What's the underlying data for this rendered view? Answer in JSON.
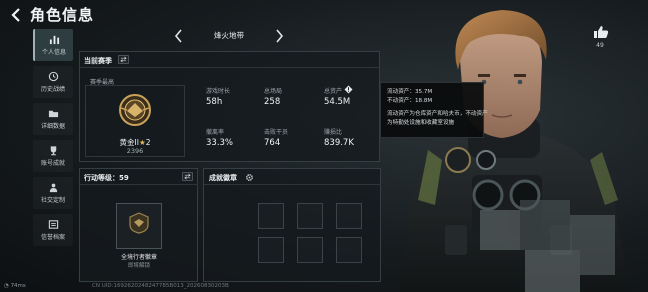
{
  "header": {
    "title": "角色信息"
  },
  "sidebar": {
    "items": [
      {
        "label": "个人信息",
        "icon": "bar-chart-icon",
        "active": true
      },
      {
        "label": "历史战绩",
        "icon": "history-icon",
        "active": false
      },
      {
        "label": "详细数据",
        "icon": "folder-icon",
        "active": false
      },
      {
        "label": "账号成就",
        "icon": "trophy-icon",
        "active": false
      },
      {
        "label": "社交定制",
        "icon": "social-icon",
        "active": false
      },
      {
        "label": "信誉档案",
        "icon": "credit-icon",
        "active": false
      }
    ]
  },
  "season": {
    "name": "烽火地带"
  },
  "current": {
    "title": "当前赛季",
    "peak_label": "赛季最高",
    "rank_name": "黄金II",
    "rank_stars": "2",
    "rank_score": "2396",
    "stats": [
      {
        "label": "游戏时长",
        "value": "58h"
      },
      {
        "label": "总场局",
        "value": "258"
      },
      {
        "label": "总资产",
        "value": "54.5M"
      },
      {
        "label": "撤离率",
        "value": "33.3%"
      },
      {
        "label": "击败干员",
        "value": "764"
      },
      {
        "label": "赚损比",
        "value": "839.7K"
      }
    ]
  },
  "tooltip": {
    "lines": [
      "流动资产：35.7M",
      "不动资产：18.8M",
      "流动资产为仓库资产和哈夫币，不动资产",
      "为特勤处设施和收藏室设施"
    ]
  },
  "level": {
    "label": "行动等级：",
    "value": "59",
    "badge_name": "全境行者徽章",
    "badge_status": "即将解锁"
  },
  "badges": {
    "title": "成就徽章"
  },
  "like": {
    "count": "49"
  },
  "footer": {
    "ping": "74ms",
    "uid": "CN UID:1692620248247785B013_20260830203B"
  },
  "colors": {
    "accent": "#c9a15a",
    "panel_border": "#353e42"
  }
}
